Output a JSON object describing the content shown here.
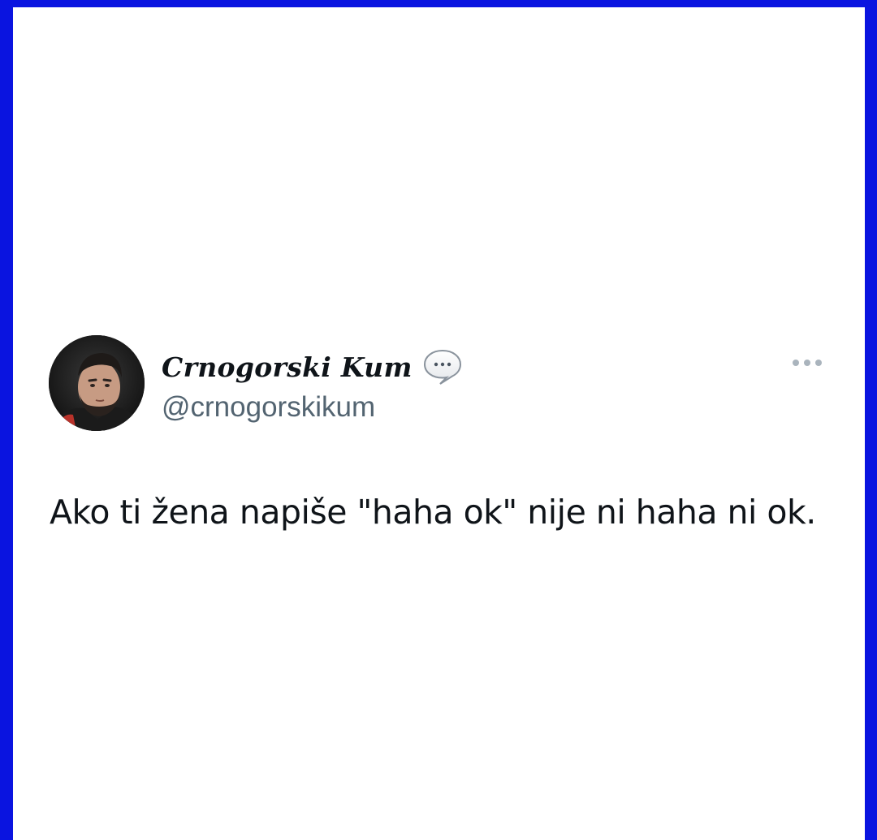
{
  "tweet": {
    "author": {
      "display_name": "Crnogorski Kum",
      "handle": "@crnogorskikum",
      "badge_icon": "speech-bubble-icon",
      "avatar_icon": "profile-photo"
    },
    "text": "Ako ti žena napiše \"haha ok\" nije ni haha ni ok.",
    "more_icon": "more-options-icon"
  },
  "colors": {
    "frame_border": "#0a14e0",
    "background": "#ffffff",
    "primary_text": "#0f1419",
    "secondary_text": "#536471"
  }
}
